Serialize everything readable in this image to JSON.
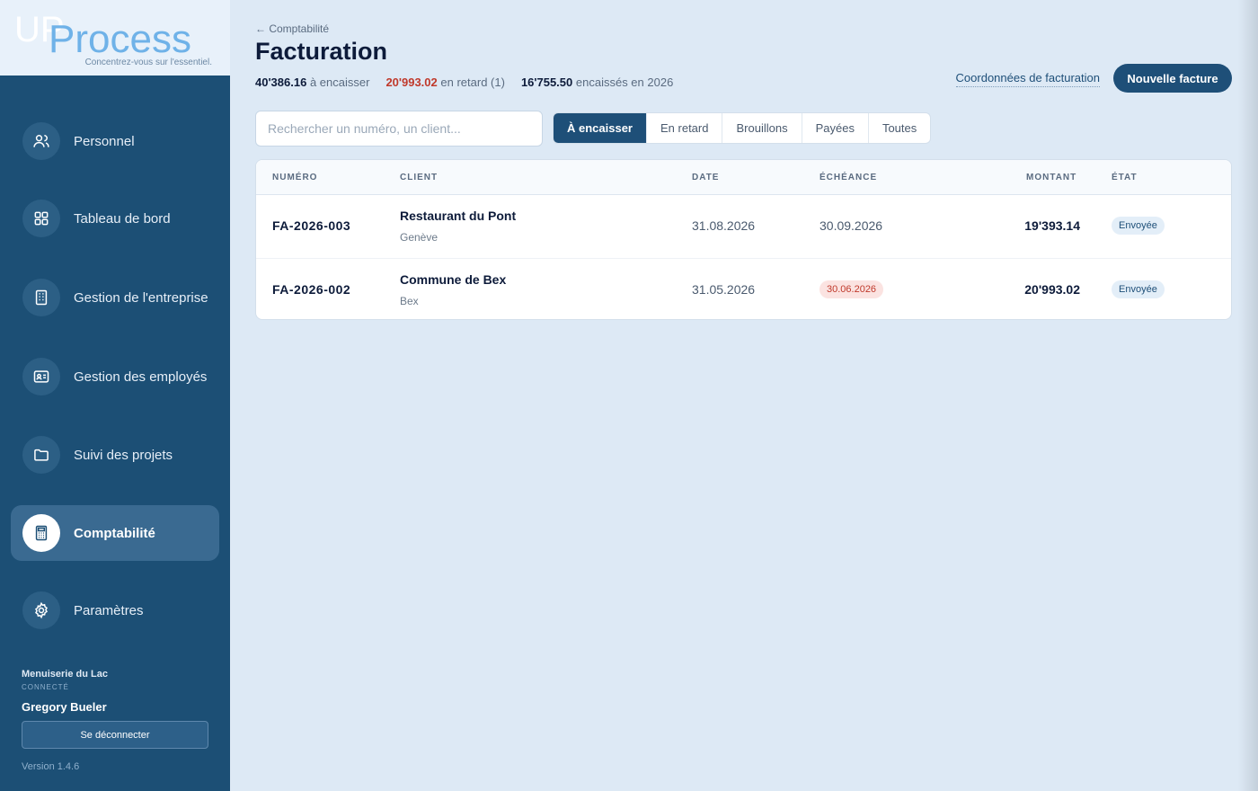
{
  "brand": {
    "name_up": "UP",
    "name_rest": "Process",
    "tagline": "Concentrez-vous sur l'essentiel."
  },
  "sidebar": {
    "items": [
      {
        "label": "Personnel",
        "icon": "users-icon"
      },
      {
        "label": "Tableau de bord",
        "icon": "grid-icon"
      },
      {
        "label": "Gestion de l'entreprise",
        "icon": "building-icon"
      },
      {
        "label": "Gestion des employés",
        "icon": "id-card-icon"
      },
      {
        "label": "Suivi des projets",
        "icon": "folder-icon"
      },
      {
        "label": "Comptabilité",
        "icon": "calculator-icon",
        "active": true
      },
      {
        "label": "Paramètres",
        "icon": "gear-icon"
      }
    ],
    "company": "Menuiserie du Lac",
    "status": "CONNECTÉ",
    "user": "Gregory Bueler",
    "logout_label": "Se déconnecter",
    "version": "Version 1.4.6"
  },
  "header": {
    "back": "← Comptabilité",
    "title": "Facturation",
    "stats": {
      "to_collect_value": "40'386.16",
      "to_collect_label": "à encaisser",
      "late_value": "20'993.02",
      "late_label": "en retard (1)",
      "collected_value": "16'755.50",
      "collected_label": "encaissés en 2026"
    },
    "billing_link": "Coordonnées de facturation",
    "new_invoice": "Nouvelle facture"
  },
  "search": {
    "placeholder": "Rechercher un numéro, un client...",
    "value": ""
  },
  "tabs": [
    {
      "label": "À encaisser",
      "active": true
    },
    {
      "label": "En retard"
    },
    {
      "label": "Brouillons"
    },
    {
      "label": "Payées"
    },
    {
      "label": "Toutes"
    }
  ],
  "table": {
    "columns": [
      "NUMÉRO",
      "CLIENT",
      "DATE",
      "ÉCHÉANCE",
      "MONTANT",
      "ÉTAT"
    ],
    "rows": [
      {
        "number": "FA-2026-003",
        "client": "Restaurant du Pont",
        "city": "Genève",
        "date": "31.08.2026",
        "due": "30.09.2026",
        "overdue": false,
        "amount": "19'393.14",
        "status": "Envoyée"
      },
      {
        "number": "FA-2026-002",
        "client": "Commune de Bex",
        "city": "Bex",
        "date": "31.05.2026",
        "due": "30.06.2026",
        "overdue": true,
        "amount": "20'993.02",
        "status": "Envoyée"
      }
    ]
  },
  "colors": {
    "sidebar": "#1c4f75",
    "accent": "#1e4f78",
    "danger": "#c0392b",
    "background": "#dde9f5"
  }
}
